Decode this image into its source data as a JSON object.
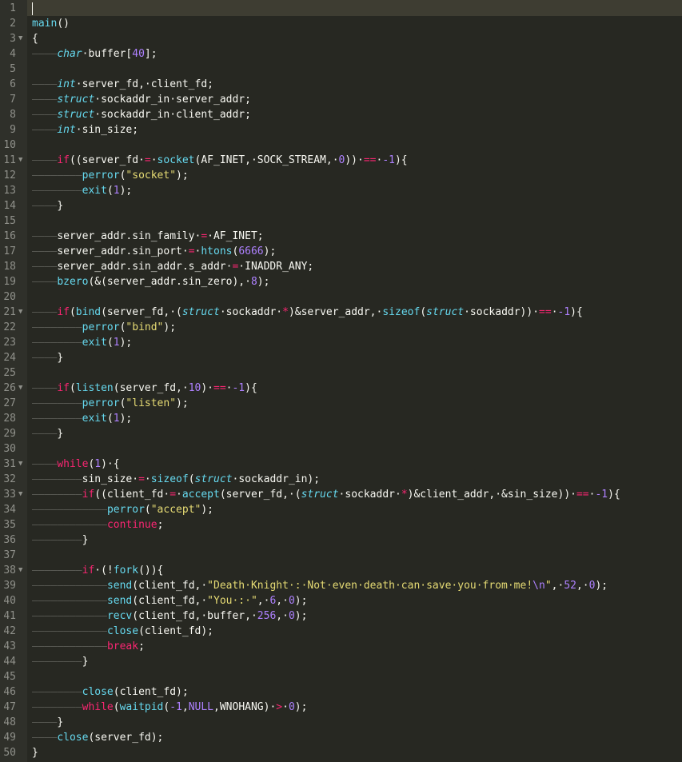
{
  "editor": {
    "theme": "monokai",
    "colors": {
      "background": "#272822",
      "keyword": "#f92672",
      "type": "#66d9ef",
      "number": "#ae81ff",
      "string": "#e6db74",
      "gutter_text": "#8f908a"
    },
    "lines": [
      {
        "n": "1",
        "fold": false,
        "indent": 0,
        "tokens": []
      },
      {
        "n": "2",
        "fold": false,
        "indent": 0,
        "tokens": [
          {
            "t": "fn",
            "v": "main"
          },
          {
            "t": "p",
            "v": "()"
          }
        ]
      },
      {
        "n": "3",
        "fold": true,
        "indent": 0,
        "tokens": [
          {
            "t": "p",
            "v": "{"
          }
        ]
      },
      {
        "n": "4",
        "fold": false,
        "indent": 1,
        "tokens": [
          {
            "t": "type",
            "v": "char"
          },
          {
            "t": "id",
            "v": "·buffer["
          },
          {
            "t": "num",
            "v": "40"
          },
          {
            "t": "p",
            "v": "];"
          }
        ]
      },
      {
        "n": "5",
        "fold": false,
        "indent": 0,
        "tokens": []
      },
      {
        "n": "6",
        "fold": false,
        "indent": 1,
        "tokens": [
          {
            "t": "type",
            "v": "int"
          },
          {
            "t": "id",
            "v": "·server_fd,·client_fd;"
          }
        ]
      },
      {
        "n": "7",
        "fold": false,
        "indent": 1,
        "tokens": [
          {
            "t": "type",
            "v": "struct"
          },
          {
            "t": "id",
            "v": "·sockaddr_in·server_addr;"
          }
        ]
      },
      {
        "n": "8",
        "fold": false,
        "indent": 1,
        "tokens": [
          {
            "t": "type",
            "v": "struct"
          },
          {
            "t": "id",
            "v": "·sockaddr_in·client_addr;"
          }
        ]
      },
      {
        "n": "9",
        "fold": false,
        "indent": 1,
        "tokens": [
          {
            "t": "type",
            "v": "int"
          },
          {
            "t": "id",
            "v": "·sin_size;"
          }
        ]
      },
      {
        "n": "10",
        "fold": false,
        "indent": 0,
        "tokens": []
      },
      {
        "n": "11",
        "fold": true,
        "indent": 1,
        "tokens": [
          {
            "t": "kw",
            "v": "if"
          },
          {
            "t": "p",
            "v": "((server_fd·"
          },
          {
            "t": "op",
            "v": "="
          },
          {
            "t": "p",
            "v": "·"
          },
          {
            "t": "fn",
            "v": "socket"
          },
          {
            "t": "p",
            "v": "(AF_INET,·SOCK_STREAM,·"
          },
          {
            "t": "num",
            "v": "0"
          },
          {
            "t": "p",
            "v": "))·"
          },
          {
            "t": "op",
            "v": "=="
          },
          {
            "t": "p",
            "v": "·"
          },
          {
            "t": "num",
            "v": "-1"
          },
          {
            "t": "p",
            "v": "){"
          }
        ]
      },
      {
        "n": "12",
        "fold": false,
        "indent": 2,
        "tokens": [
          {
            "t": "fn",
            "v": "perror"
          },
          {
            "t": "p",
            "v": "("
          },
          {
            "t": "str",
            "v": "\"socket\""
          },
          {
            "t": "p",
            "v": ");"
          }
        ]
      },
      {
        "n": "13",
        "fold": false,
        "indent": 2,
        "tokens": [
          {
            "t": "fn",
            "v": "exit"
          },
          {
            "t": "p",
            "v": "("
          },
          {
            "t": "num",
            "v": "1"
          },
          {
            "t": "p",
            "v": ");"
          }
        ]
      },
      {
        "n": "14",
        "fold": false,
        "indent": 1,
        "tokens": [
          {
            "t": "p",
            "v": "}"
          }
        ]
      },
      {
        "n": "15",
        "fold": false,
        "indent": 0,
        "tokens": []
      },
      {
        "n": "16",
        "fold": false,
        "indent": 1,
        "tokens": [
          {
            "t": "id",
            "v": "server_addr.sin_family·"
          },
          {
            "t": "op",
            "v": "="
          },
          {
            "t": "id",
            "v": "·AF_INET;"
          }
        ]
      },
      {
        "n": "17",
        "fold": false,
        "indent": 1,
        "tokens": [
          {
            "t": "id",
            "v": "server_addr.sin_port·"
          },
          {
            "t": "op",
            "v": "="
          },
          {
            "t": "p",
            "v": "·"
          },
          {
            "t": "fn",
            "v": "htons"
          },
          {
            "t": "p",
            "v": "("
          },
          {
            "t": "num",
            "v": "6666"
          },
          {
            "t": "p",
            "v": ");"
          }
        ]
      },
      {
        "n": "18",
        "fold": false,
        "indent": 1,
        "tokens": [
          {
            "t": "id",
            "v": "server_addr.sin_addr.s_addr·"
          },
          {
            "t": "op",
            "v": "="
          },
          {
            "t": "id",
            "v": "·INADDR_ANY;"
          }
        ]
      },
      {
        "n": "19",
        "fold": false,
        "indent": 1,
        "tokens": [
          {
            "t": "fn",
            "v": "bzero"
          },
          {
            "t": "p",
            "v": "(&(server_addr.sin_zero),·"
          },
          {
            "t": "num",
            "v": "8"
          },
          {
            "t": "p",
            "v": ");"
          }
        ]
      },
      {
        "n": "20",
        "fold": false,
        "indent": 0,
        "tokens": []
      },
      {
        "n": "21",
        "fold": true,
        "indent": 1,
        "tokens": [
          {
            "t": "kw",
            "v": "if"
          },
          {
            "t": "p",
            "v": "("
          },
          {
            "t": "fn",
            "v": "bind"
          },
          {
            "t": "p",
            "v": "(server_fd,·("
          },
          {
            "t": "type",
            "v": "struct"
          },
          {
            "t": "p",
            "v": "·sockaddr·"
          },
          {
            "t": "op",
            "v": "*"
          },
          {
            "t": "p",
            "v": ")&server_addr,·"
          },
          {
            "t": "fn",
            "v": "sizeof"
          },
          {
            "t": "p",
            "v": "("
          },
          {
            "t": "type",
            "v": "struct"
          },
          {
            "t": "p",
            "v": "·sockaddr))·"
          },
          {
            "t": "op",
            "v": "=="
          },
          {
            "t": "p",
            "v": "·"
          },
          {
            "t": "num",
            "v": "-1"
          },
          {
            "t": "p",
            "v": "){"
          }
        ]
      },
      {
        "n": "22",
        "fold": false,
        "indent": 2,
        "tokens": [
          {
            "t": "fn",
            "v": "perror"
          },
          {
            "t": "p",
            "v": "("
          },
          {
            "t": "str",
            "v": "\"bind\""
          },
          {
            "t": "p",
            "v": ");"
          }
        ]
      },
      {
        "n": "23",
        "fold": false,
        "indent": 2,
        "tokens": [
          {
            "t": "fn",
            "v": "exit"
          },
          {
            "t": "p",
            "v": "("
          },
          {
            "t": "num",
            "v": "1"
          },
          {
            "t": "p",
            "v": ");"
          }
        ]
      },
      {
        "n": "24",
        "fold": false,
        "indent": 1,
        "tokens": [
          {
            "t": "p",
            "v": "}"
          }
        ]
      },
      {
        "n": "25",
        "fold": false,
        "indent": 0,
        "tokens": []
      },
      {
        "n": "26",
        "fold": true,
        "indent": 1,
        "tokens": [
          {
            "t": "kw",
            "v": "if"
          },
          {
            "t": "p",
            "v": "("
          },
          {
            "t": "fn",
            "v": "listen"
          },
          {
            "t": "p",
            "v": "(server_fd,·"
          },
          {
            "t": "num",
            "v": "10"
          },
          {
            "t": "p",
            "v": ")·"
          },
          {
            "t": "op",
            "v": "=="
          },
          {
            "t": "p",
            "v": "·"
          },
          {
            "t": "num",
            "v": "-1"
          },
          {
            "t": "p",
            "v": "){"
          }
        ]
      },
      {
        "n": "27",
        "fold": false,
        "indent": 2,
        "tokens": [
          {
            "t": "fn",
            "v": "perror"
          },
          {
            "t": "p",
            "v": "("
          },
          {
            "t": "str",
            "v": "\"listen\""
          },
          {
            "t": "p",
            "v": ");"
          }
        ]
      },
      {
        "n": "28",
        "fold": false,
        "indent": 2,
        "tokens": [
          {
            "t": "fn",
            "v": "exit"
          },
          {
            "t": "p",
            "v": "("
          },
          {
            "t": "num",
            "v": "1"
          },
          {
            "t": "p",
            "v": ");"
          }
        ]
      },
      {
        "n": "29",
        "fold": false,
        "indent": 1,
        "tokens": [
          {
            "t": "p",
            "v": "}"
          }
        ]
      },
      {
        "n": "30",
        "fold": false,
        "indent": 0,
        "tokens": []
      },
      {
        "n": "31",
        "fold": true,
        "indent": 1,
        "tokens": [
          {
            "t": "kw",
            "v": "while"
          },
          {
            "t": "p",
            "v": "("
          },
          {
            "t": "num",
            "v": "1"
          },
          {
            "t": "p",
            "v": ")·{"
          }
        ]
      },
      {
        "n": "32",
        "fold": false,
        "indent": 2,
        "tokens": [
          {
            "t": "id",
            "v": "sin_size·"
          },
          {
            "t": "op",
            "v": "="
          },
          {
            "t": "p",
            "v": "·"
          },
          {
            "t": "fn",
            "v": "sizeof"
          },
          {
            "t": "p",
            "v": "("
          },
          {
            "t": "type",
            "v": "struct"
          },
          {
            "t": "p",
            "v": "·sockaddr_in);"
          }
        ]
      },
      {
        "n": "33",
        "fold": true,
        "indent": 2,
        "tokens": [
          {
            "t": "kw",
            "v": "if"
          },
          {
            "t": "p",
            "v": "((client_fd·"
          },
          {
            "t": "op",
            "v": "="
          },
          {
            "t": "p",
            "v": "·"
          },
          {
            "t": "fn",
            "v": "accept"
          },
          {
            "t": "p",
            "v": "(server_fd,·("
          },
          {
            "t": "type",
            "v": "struct"
          },
          {
            "t": "p",
            "v": "·sockaddr·"
          },
          {
            "t": "op",
            "v": "*"
          },
          {
            "t": "p",
            "v": ")&client_addr,·&sin_size))·"
          },
          {
            "t": "op",
            "v": "=="
          },
          {
            "t": "p",
            "v": "·"
          },
          {
            "t": "num",
            "v": "-1"
          },
          {
            "t": "p",
            "v": "){"
          }
        ]
      },
      {
        "n": "34",
        "fold": false,
        "indent": 3,
        "tokens": [
          {
            "t": "fn",
            "v": "perror"
          },
          {
            "t": "p",
            "v": "("
          },
          {
            "t": "str",
            "v": "\"accept\""
          },
          {
            "t": "p",
            "v": ");"
          }
        ]
      },
      {
        "n": "35",
        "fold": false,
        "indent": 3,
        "tokens": [
          {
            "t": "kw",
            "v": "continue"
          },
          {
            "t": "p",
            "v": ";"
          }
        ]
      },
      {
        "n": "36",
        "fold": false,
        "indent": 2,
        "tokens": [
          {
            "t": "p",
            "v": "}"
          }
        ]
      },
      {
        "n": "37",
        "fold": false,
        "indent": 0,
        "tokens": []
      },
      {
        "n": "38",
        "fold": true,
        "indent": 2,
        "tokens": [
          {
            "t": "kw",
            "v": "if"
          },
          {
            "t": "p",
            "v": "·(!"
          },
          {
            "t": "fn",
            "v": "fork"
          },
          {
            "t": "p",
            "v": "()){"
          }
        ]
      },
      {
        "n": "39",
        "fold": false,
        "indent": 3,
        "tokens": [
          {
            "t": "fn",
            "v": "send"
          },
          {
            "t": "p",
            "v": "(client_fd,·"
          },
          {
            "t": "str",
            "v": "\"Death·Knight·:·Not·even·death·can·save·you·from·me!"
          },
          {
            "t": "num",
            "v": "\\n"
          },
          {
            "t": "str",
            "v": "\""
          },
          {
            "t": "p",
            "v": ",·"
          },
          {
            "t": "num",
            "v": "52"
          },
          {
            "t": "p",
            "v": ",·"
          },
          {
            "t": "num",
            "v": "0"
          },
          {
            "t": "p",
            "v": ");"
          }
        ]
      },
      {
        "n": "40",
        "fold": false,
        "indent": 3,
        "tokens": [
          {
            "t": "fn",
            "v": "send"
          },
          {
            "t": "p",
            "v": "(client_fd,·"
          },
          {
            "t": "str",
            "v": "\"You·:·\""
          },
          {
            "t": "p",
            "v": ",·"
          },
          {
            "t": "num",
            "v": "6"
          },
          {
            "t": "p",
            "v": ",·"
          },
          {
            "t": "num",
            "v": "0"
          },
          {
            "t": "p",
            "v": ");"
          }
        ]
      },
      {
        "n": "41",
        "fold": false,
        "indent": 3,
        "tokens": [
          {
            "t": "fn",
            "v": "recv"
          },
          {
            "t": "p",
            "v": "(client_fd,·buffer,·"
          },
          {
            "t": "num",
            "v": "256"
          },
          {
            "t": "p",
            "v": ",·"
          },
          {
            "t": "num",
            "v": "0"
          },
          {
            "t": "p",
            "v": ");"
          }
        ]
      },
      {
        "n": "42",
        "fold": false,
        "indent": 3,
        "tokens": [
          {
            "t": "fn",
            "v": "close"
          },
          {
            "t": "p",
            "v": "(client_fd);"
          }
        ]
      },
      {
        "n": "43",
        "fold": false,
        "indent": 3,
        "tokens": [
          {
            "t": "kw",
            "v": "break"
          },
          {
            "t": "p",
            "v": ";"
          }
        ]
      },
      {
        "n": "44",
        "fold": false,
        "indent": 2,
        "tokens": [
          {
            "t": "p",
            "v": "}"
          }
        ]
      },
      {
        "n": "45",
        "fold": false,
        "indent": 0,
        "tokens": []
      },
      {
        "n": "46",
        "fold": false,
        "indent": 2,
        "tokens": [
          {
            "t": "fn",
            "v": "close"
          },
          {
            "t": "p",
            "v": "(client_fd);"
          }
        ]
      },
      {
        "n": "47",
        "fold": false,
        "indent": 2,
        "tokens": [
          {
            "t": "kw",
            "v": "while"
          },
          {
            "t": "p",
            "v": "("
          },
          {
            "t": "fn",
            "v": "waitpid"
          },
          {
            "t": "p",
            "v": "("
          },
          {
            "t": "num",
            "v": "-1"
          },
          {
            "t": "p",
            "v": ","
          },
          {
            "t": "const",
            "v": "NULL"
          },
          {
            "t": "p",
            "v": ",WNOHANG)·"
          },
          {
            "t": "op",
            "v": ">"
          },
          {
            "t": "p",
            "v": "·"
          },
          {
            "t": "num",
            "v": "0"
          },
          {
            "t": "p",
            "v": ");"
          }
        ]
      },
      {
        "n": "48",
        "fold": false,
        "indent": 1,
        "tokens": [
          {
            "t": "p",
            "v": "}"
          }
        ]
      },
      {
        "n": "49",
        "fold": false,
        "indent": 1,
        "tokens": [
          {
            "t": "fn",
            "v": "close"
          },
          {
            "t": "p",
            "v": "(server_fd);"
          }
        ]
      },
      {
        "n": "50",
        "fold": false,
        "indent": 0,
        "tokens": [
          {
            "t": "p",
            "v": "}"
          }
        ]
      }
    ]
  }
}
